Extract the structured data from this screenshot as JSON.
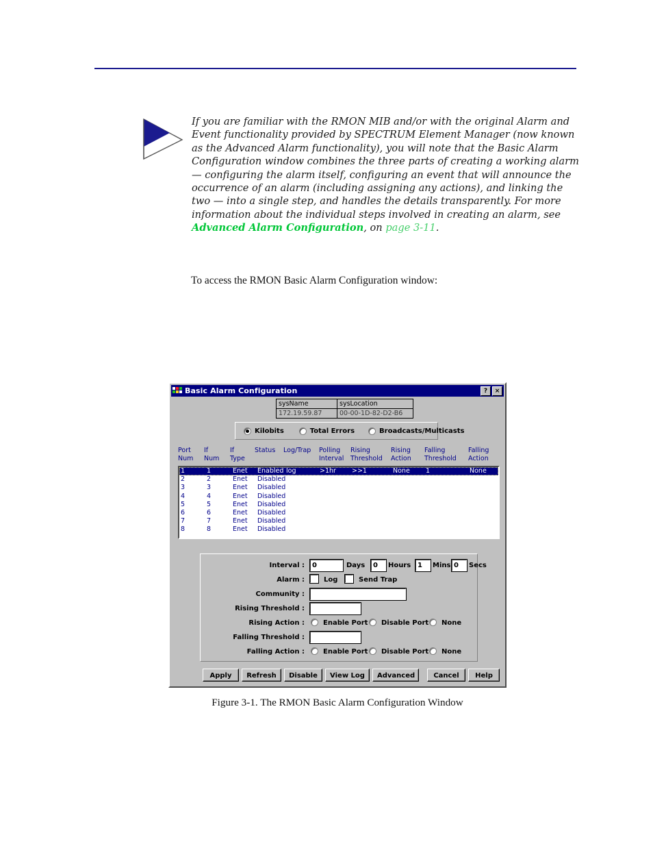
{
  "note": {
    "icon": "triangle-arrow-note-icon",
    "text_part1": "If you are familiar with the RMON MIB and/or with the original Alarm and Event functionality provided by SPECTRUM Element Manager (now known as the Advanced Alarm functionality), you will note that the Basic Alarm Configuration window combines the three parts of creating a working alarm — configuring the alarm itself, configuring an event that will announce the occurrence of an alarm (including assigning any actions), and linking the two — into a single step, and handles the details transparently. For more information about the individual steps involved in creating an alarm, see ",
    "link_bold": "Advanced Alarm Configuration",
    "text_mid": ", on ",
    "link_page": "page 3-11",
    "text_end": ".",
    "link_bold_color": "#00c637",
    "link_page_color": "#45cf6a"
  },
  "body_paragraph": "To access the RMON Basic Alarm Configuration window:",
  "figure_caption": "Figure 3-1.  The RMON Basic Alarm Configuration Window",
  "dialog": {
    "title": "Basic Alarm Configuration",
    "titlebar_color": "#000080",
    "face_color": "#c0c0c0",
    "help_button": "?",
    "close_button": "×",
    "sysinfo": {
      "headers": [
        "sysName",
        "sysLocation"
      ],
      "values": [
        "172.19.59.87",
        "00-00-1D-82-D2-B6"
      ]
    },
    "metric_radios": {
      "selected": "Kilobits",
      "options": [
        "Kilobits",
        "Total Errors",
        "Broadcasts/Multicasts"
      ]
    },
    "table": {
      "columns": [
        {
          "line1": "Port",
          "line2": "Num"
        },
        {
          "line1": "If",
          "line2": "Num"
        },
        {
          "line1": "If",
          "line2": "Type"
        },
        {
          "line1": "",
          "line2": "Status"
        },
        {
          "line1": "",
          "line2": "Log/Trap"
        },
        {
          "line1": "Polling",
          "line2": "Interval"
        },
        {
          "line1": "Rising",
          "line2": "Threshold"
        },
        {
          "line1": "Rising",
          "line2": "Action"
        },
        {
          "line1": "Falling",
          "line2": "Threshold"
        },
        {
          "line1": "Falling",
          "line2": "Action"
        }
      ],
      "rows": [
        {
          "selected": true,
          "cells": [
            "1",
            "1",
            "Enet",
            "Enabled",
            "log",
            ">1hr",
            ">>1",
            "None",
            "1",
            "None"
          ]
        },
        {
          "selected": false,
          "cells": [
            "2",
            "2",
            "Enet",
            "Disabled",
            "",
            "",
            "",
            "",
            "",
            ""
          ]
        },
        {
          "selected": false,
          "cells": [
            "3",
            "3",
            "Enet",
            "Disabled",
            "",
            "",
            "",
            "",
            "",
            ""
          ]
        },
        {
          "selected": false,
          "cells": [
            "4",
            "4",
            "Enet",
            "Disabled",
            "",
            "",
            "",
            "",
            "",
            ""
          ]
        },
        {
          "selected": false,
          "cells": [
            "5",
            "5",
            "Enet",
            "Disabled",
            "",
            "",
            "",
            "",
            "",
            ""
          ]
        },
        {
          "selected": false,
          "cells": [
            "6",
            "6",
            "Enet",
            "Disabled",
            "",
            "",
            "",
            "",
            "",
            ""
          ]
        },
        {
          "selected": false,
          "cells": [
            "7",
            "7",
            "Enet",
            "Disabled",
            "",
            "",
            "",
            "",
            "",
            ""
          ]
        },
        {
          "selected": false,
          "cells": [
            "8",
            "8",
            "Enet",
            "Disabled",
            "",
            "",
            "",
            "",
            "",
            ""
          ]
        }
      ]
    },
    "form": {
      "interval_label": "Interval :",
      "interval_days_value": "0",
      "interval_days_unit": "Days",
      "interval_hours_value": "0",
      "interval_hours_unit": "Hours",
      "interval_mins_value": "1",
      "interval_mins_unit": "Mins",
      "interval_secs_value": "0",
      "interval_secs_unit": "Secs",
      "alarm_label": "Alarm :",
      "alarm_log_label": "Log",
      "alarm_log_checked": false,
      "alarm_trap_label": "Send Trap",
      "alarm_trap_checked": false,
      "community_label": "Community :",
      "community_value": "",
      "rising_threshold_label": "Rising Threshold :",
      "rising_threshold_value": "",
      "rising_action_label": "Rising Action :",
      "rising_action_options": [
        "Enable Port",
        "Disable Port",
        "None"
      ],
      "rising_action_selected": "",
      "falling_threshold_label": "Falling Threshold :",
      "falling_threshold_value": "",
      "falling_action_label": "Falling Action :",
      "falling_action_options": [
        "Enable Port",
        "Disable Port",
        "None"
      ],
      "falling_action_selected": ""
    },
    "buttons": [
      "Apply",
      "Refresh",
      "Disable",
      "View Log",
      "Advanced",
      "Cancel",
      "Help"
    ]
  }
}
